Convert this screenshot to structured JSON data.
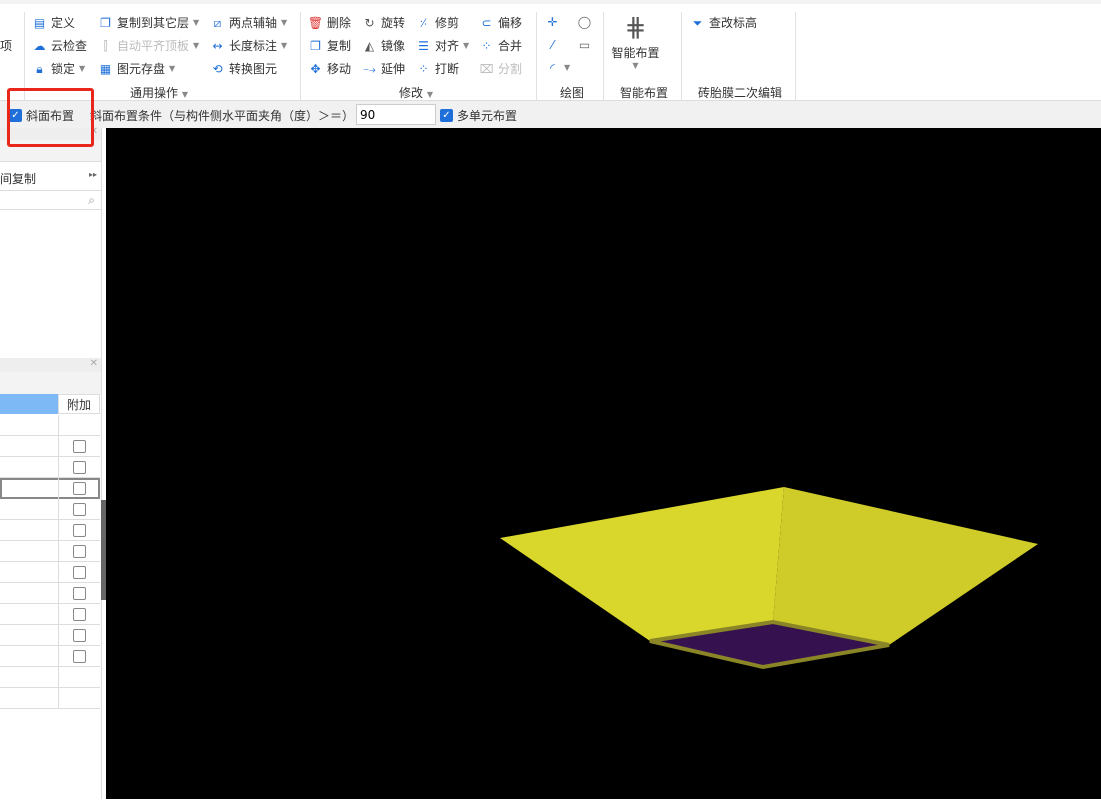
{
  "ribbon": {
    "left_partial": "项",
    "general": {
      "define": "定义",
      "cloud_check": "云检查",
      "lock": "锁定",
      "copy_to_layer": "复制到其它层",
      "auto_align": "自动平齐顶板",
      "save_elements": "图元存盘",
      "two_point_axis": "两点辅轴",
      "length_dim": "长度标注",
      "convert": "转换图元",
      "group": "通用操作"
    },
    "modify": {
      "delete": "删除",
      "rotate": "旋转",
      "trim": "修剪",
      "offset": "偏移",
      "copy": "复制",
      "mirror": "镜像",
      "align": "对齐",
      "merge": "合并",
      "move": "移动",
      "extend": "延伸",
      "break": "打断",
      "split": "分割",
      "group": "修改"
    },
    "draw": {
      "group": "绘图"
    },
    "smart": {
      "label": "智能布置",
      "group": "智能布置"
    },
    "brick": {
      "check_elev": "查改标高",
      "group": "砖胎膜二次编辑"
    }
  },
  "options": {
    "slope_layout": "斜面布置",
    "slope_condition": "斜面布置条件（与构件侧水平面夹角（度）＞＝）",
    "angle_value": "90",
    "multi_unit": "多单元布置"
  },
  "panel": {
    "copy_partial": "间复制",
    "header_extra": "附加",
    "rows_checkbox_count": 11
  },
  "colors": {
    "accent": "#1e6fd9",
    "highlight": "#e8261c",
    "face_left": "#d9d62c",
    "face_right": "#cfcc29",
    "pit_bottom": "#36114f"
  }
}
